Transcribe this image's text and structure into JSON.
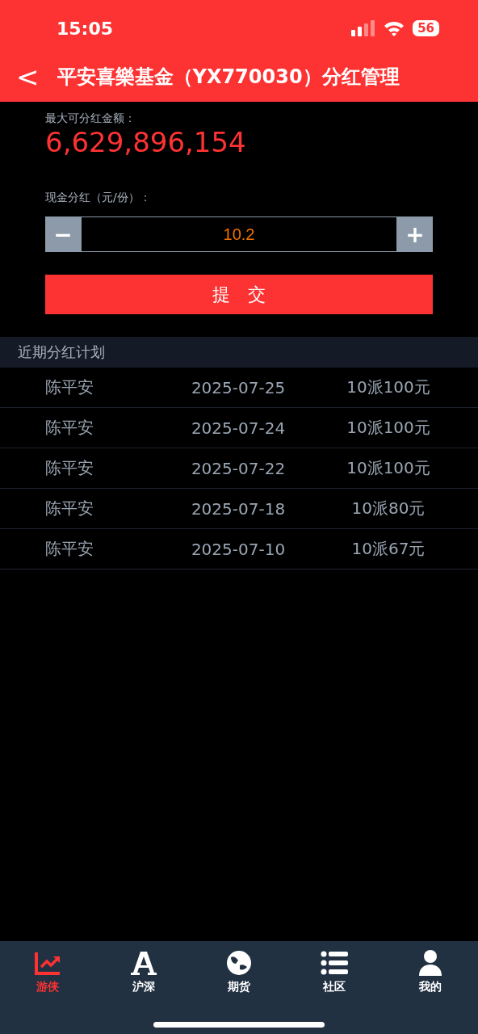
{
  "status_bar": {
    "time": "15:05",
    "battery": "56"
  },
  "header": {
    "back": "<",
    "title": "平安喜樂基金（YX770030）分红管理"
  },
  "max_amount": {
    "label": "最大可分红金额：",
    "value": "6,629,896,154"
  },
  "cash_dividend": {
    "label": "现金分红（元/份）：",
    "minus": "−",
    "value": "10.2",
    "plus": "+"
  },
  "submit": "提　交",
  "plans": {
    "title": "近期分红计划",
    "rows": [
      {
        "name": "陈平安",
        "date": "2025-07-25",
        "plan": "10派100元"
      },
      {
        "name": "陈平安",
        "date": "2025-07-24",
        "plan": "10派100元"
      },
      {
        "name": "陈平安",
        "date": "2025-07-22",
        "plan": "10派100元"
      },
      {
        "name": "陈平安",
        "date": "2025-07-18",
        "plan": "10派80元"
      },
      {
        "name": "陈平安",
        "date": "2025-07-10",
        "plan": "10派67元"
      }
    ]
  },
  "tabs": [
    {
      "kind": "chart",
      "label": "游侠",
      "selected": true
    },
    {
      "kind": "font",
      "label": "沪深",
      "selected": false
    },
    {
      "kind": "globe",
      "label": "期货",
      "selected": false
    },
    {
      "kind": "list",
      "label": "社区",
      "selected": false
    },
    {
      "kind": "user",
      "label": "我的",
      "selected": false
    }
  ]
}
